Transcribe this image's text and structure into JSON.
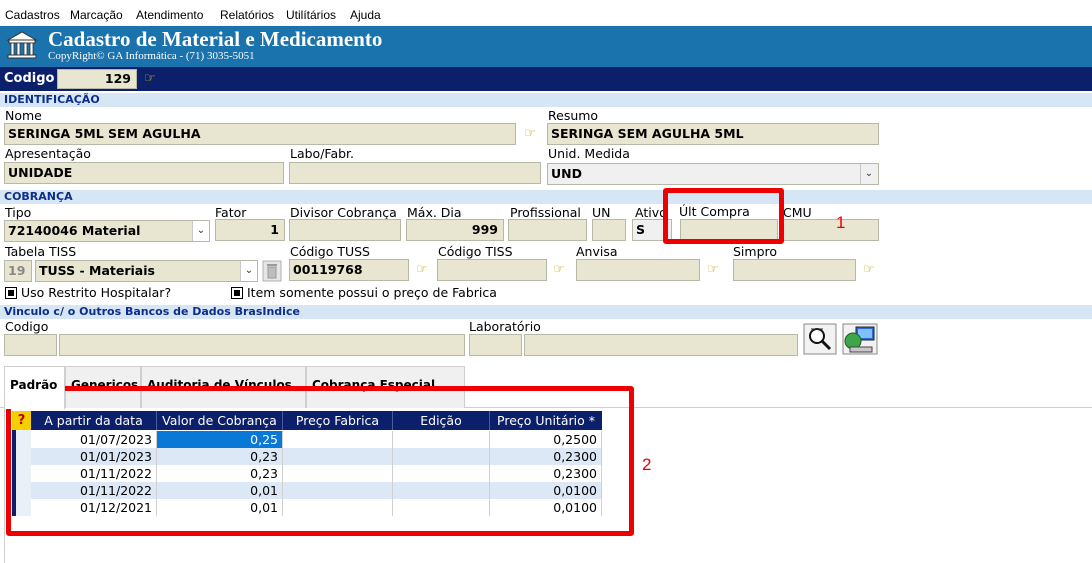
{
  "menu": [
    "Cadastros",
    "Marcação",
    "Atendimento",
    "Relatórios",
    "Utilítários",
    "Ajuda"
  ],
  "title": {
    "main": "Cadastro de Material e Medicamento",
    "sub": "CopyRight© GA Informática - (71) 3035-5051",
    "logo_icon": "building-columns-icon"
  },
  "codigo": {
    "label": "Codigo",
    "value": "129"
  },
  "sections": {
    "identificacao": "IDENTIFICAÇÃO",
    "cobranca": "COBRANÇA",
    "vinculo": "Vinculo c/ o Outros Bancos de Dados BrasIndice"
  },
  "identificacao": {
    "nome_label": "Nome",
    "nome_value": "SERINGA 5ML SEM AGULHA",
    "resumo_label": "Resumo",
    "resumo_value": "SERINGA SEM AGULHA 5ML",
    "apresentacao_label": "Apresentação",
    "apresentacao_value": "UNIDADE",
    "labo_label": "Labo/Fabr.",
    "labo_value": "",
    "unid_label": "Unid. Medida",
    "unid_value": "UND"
  },
  "cobranca": {
    "tipo_label": "Tipo",
    "tipo_value": "72140046 Material",
    "fator_label": "Fator",
    "fator_value": "1",
    "divisor_label": "Divisor Cobrança",
    "divisor_value": "",
    "maxdia_label": "Máx. Dia",
    "maxdia_value": "999",
    "profissional_label": "Profissional",
    "profissional_value": "",
    "un_label": "UN",
    "un_value": "",
    "ativo_label": "Ativo",
    "ativo_value": "S",
    "ultcompra_label": "Últ Compra",
    "ultcompra_value": "",
    "cmu_label": "CMU",
    "cmu_value": "",
    "tabela_label": "Tabela TISS",
    "tabela_code": "19",
    "tabela_value": "TUSS - Materiais",
    "codtuss_label": "Código TUSS",
    "codtuss_value": "00119768",
    "codtiss_label": "Código TISS",
    "codtiss_value": "",
    "anvisa_label": "Anvisa",
    "anvisa_value": "",
    "simpro_label": "Simpro",
    "simpro_value": "",
    "uso_restrito": "Uso Restrito Hospitalar?",
    "item_fabrica": "Item somente possui o preço de Fabrica"
  },
  "vinculo": {
    "codigo_label": "Codigo",
    "laboratorio_label": "Laboratório"
  },
  "annotations": [
    "1",
    "2"
  ],
  "tabs": [
    "Padrão",
    "Genericos",
    "Auditoria de Vínculos",
    "Cobrança Especial"
  ],
  "grid": {
    "corner": "?",
    "columns": [
      "A partir da data",
      "Valor de Cobrança",
      "Preço Fabrica",
      "Edição",
      "Preço Unitário *"
    ],
    "rows": [
      [
        "01/07/2023",
        "0,25",
        "",
        "",
        "0,2500"
      ],
      [
        "01/01/2023",
        "0,23",
        "",
        "",
        "0,2300"
      ],
      [
        "01/11/2022",
        "0,23",
        "",
        "",
        "0,2300"
      ],
      [
        "01/11/2022",
        "0,01",
        "",
        "",
        "0,0100"
      ],
      [
        "01/12/2021",
        "0,01",
        "",
        "",
        "0,0100"
      ]
    ]
  },
  "colors": {
    "title_bar": "#1a73ad",
    "dark_bar": "#0c1f6a",
    "section_bg": "#d6e6f5",
    "field_bg": "#e8e6d0",
    "highlight": "#ee0000"
  }
}
